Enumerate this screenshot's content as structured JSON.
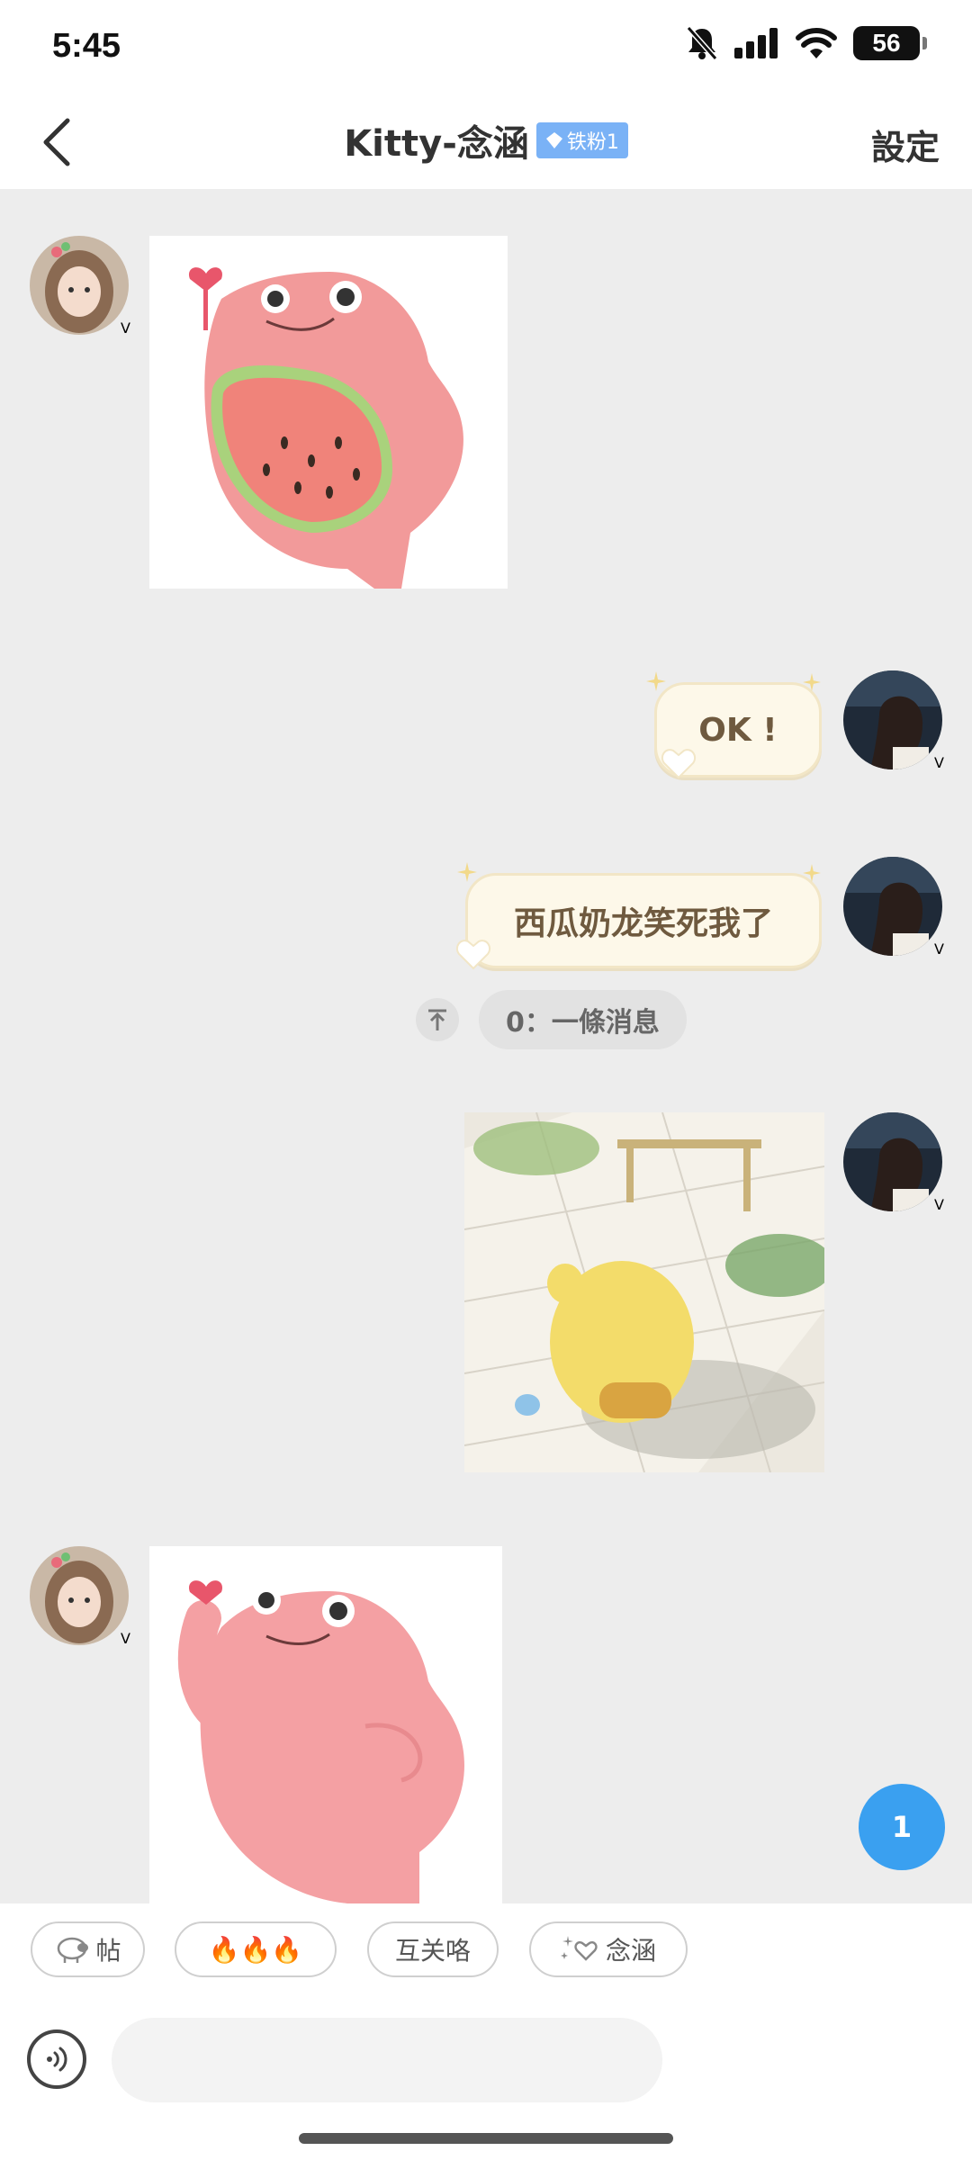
{
  "status_bar": {
    "time": "5:45",
    "battery": "56",
    "icons": [
      "mute-bell-icon",
      "signal-icon",
      "wifi-icon",
      "battery-icon"
    ]
  },
  "header": {
    "title": "Kitty-念涵",
    "badge": "铁粉1",
    "settings_label": "設定",
    "back_icon": "chevron-left-icon"
  },
  "messages": [
    {
      "side": "left",
      "type": "sticker-image",
      "sticker": "pink-watermelon-blob"
    },
    {
      "side": "right",
      "type": "sticker-text",
      "text": "OK !"
    },
    {
      "side": "right",
      "type": "sticker-text",
      "text": "西瓜奶龙笑死我了"
    },
    {
      "side": "right",
      "type": "sticker-image",
      "sticker": "yellow-creature-walking"
    },
    {
      "side": "left",
      "type": "sticker-image",
      "sticker": "pink-blob"
    }
  ],
  "read_status": {
    "icon": "scroll-top-icon",
    "text": "0：一條消息"
  },
  "unread_count": "1",
  "quick_replies": [
    {
      "icon": "sheep-icon",
      "label": "帖"
    },
    {
      "label": "🔥🔥🔥"
    },
    {
      "label": "互关咯"
    },
    {
      "icon": "sparkle-heart-icon",
      "label": "念涵"
    }
  ],
  "composer": {
    "placeholder": "",
    "voice_icon": "voice-icon"
  },
  "colors": {
    "chat_background": "#ededed",
    "verified_badge": "#f08a1c",
    "fan_badge": "#7ab2f6",
    "unread_fab": "#3aa0f0",
    "sticker_bubble": "#fdf8e9"
  }
}
